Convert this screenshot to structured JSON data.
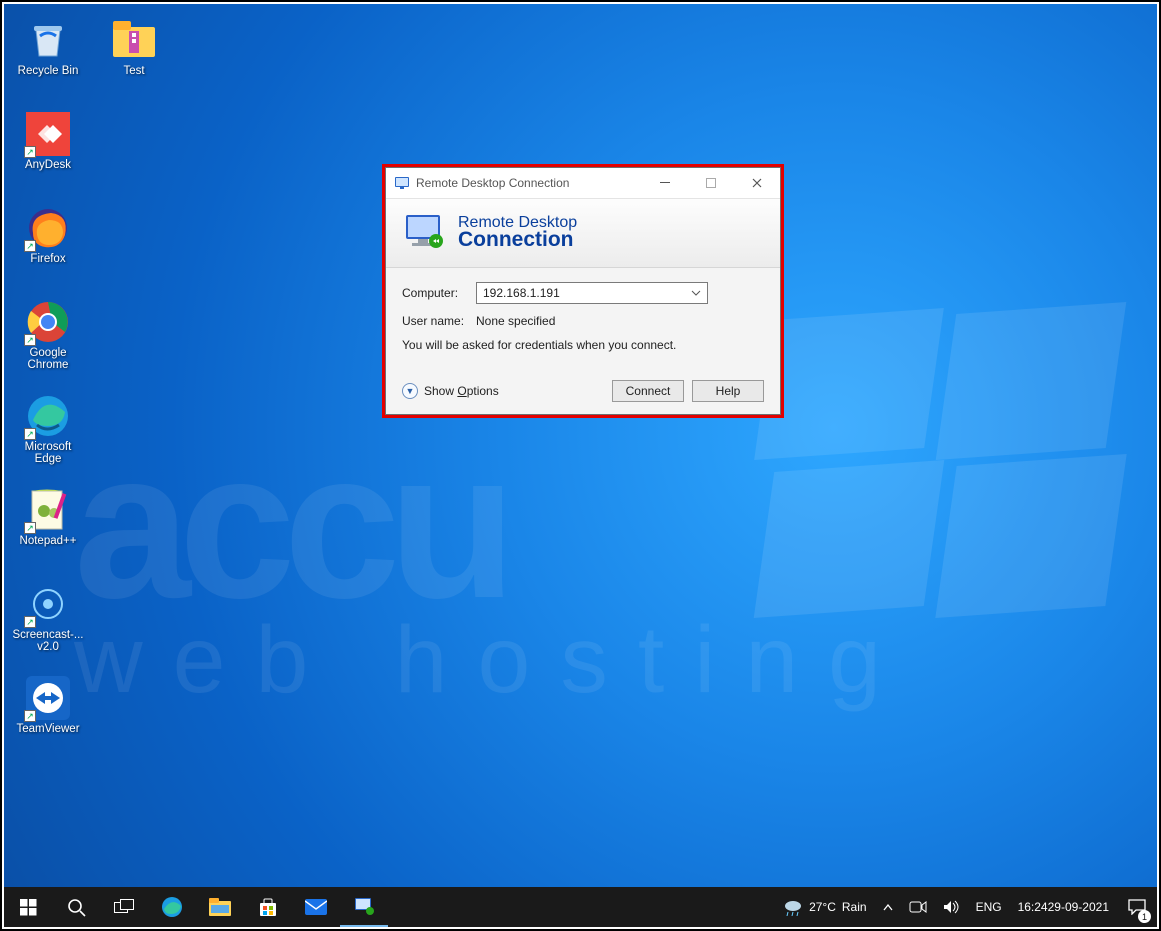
{
  "desktop_icons_col1": [
    {
      "label": "Recycle Bin",
      "name": "recycle-bin",
      "shortcut": false,
      "svg": "bin"
    },
    {
      "label": "AnyDesk",
      "name": "anydesk",
      "shortcut": true,
      "svg": "anydesk"
    },
    {
      "label": "Firefox",
      "name": "firefox",
      "shortcut": true,
      "svg": "firefox"
    },
    {
      "label": "Google Chrome",
      "name": "google-chrome",
      "shortcut": true,
      "svg": "chrome"
    },
    {
      "label": "Microsoft Edge",
      "name": "microsoft-edge",
      "shortcut": true,
      "svg": "edge"
    },
    {
      "label": "Notepad++",
      "name": "notepadpp",
      "shortcut": true,
      "svg": "notepadpp"
    },
    {
      "label": "Screencast-... v2.0",
      "name": "screencast",
      "shortcut": true,
      "svg": "screencast"
    },
    {
      "label": "TeamViewer",
      "name": "teamviewer",
      "shortcut": true,
      "svg": "teamviewer"
    }
  ],
  "desktop_icons_col2": [
    {
      "label": "Test",
      "name": "test-folder",
      "shortcut": false,
      "svg": "folder-zip"
    }
  ],
  "watermark": {
    "line1": "accu",
    "line2": "web hosting"
  },
  "rdc": {
    "window_title": "Remote Desktop Connection",
    "banner_line1": "Remote Desktop",
    "banner_line2": "Connection",
    "computer_label": "Computer:",
    "computer_value": "192.168.1.191",
    "username_label": "User name:",
    "username_value": "None specified",
    "info_text": "You will be asked for credentials when you connect.",
    "show_options": "Show Options",
    "connect": "Connect",
    "help": "Help"
  },
  "taskbar": {
    "weather_temp": "27°C",
    "weather_cond": "Rain",
    "lang": "ENG",
    "time": "16:24",
    "date": "29-09-2021",
    "notif_count": "1"
  }
}
